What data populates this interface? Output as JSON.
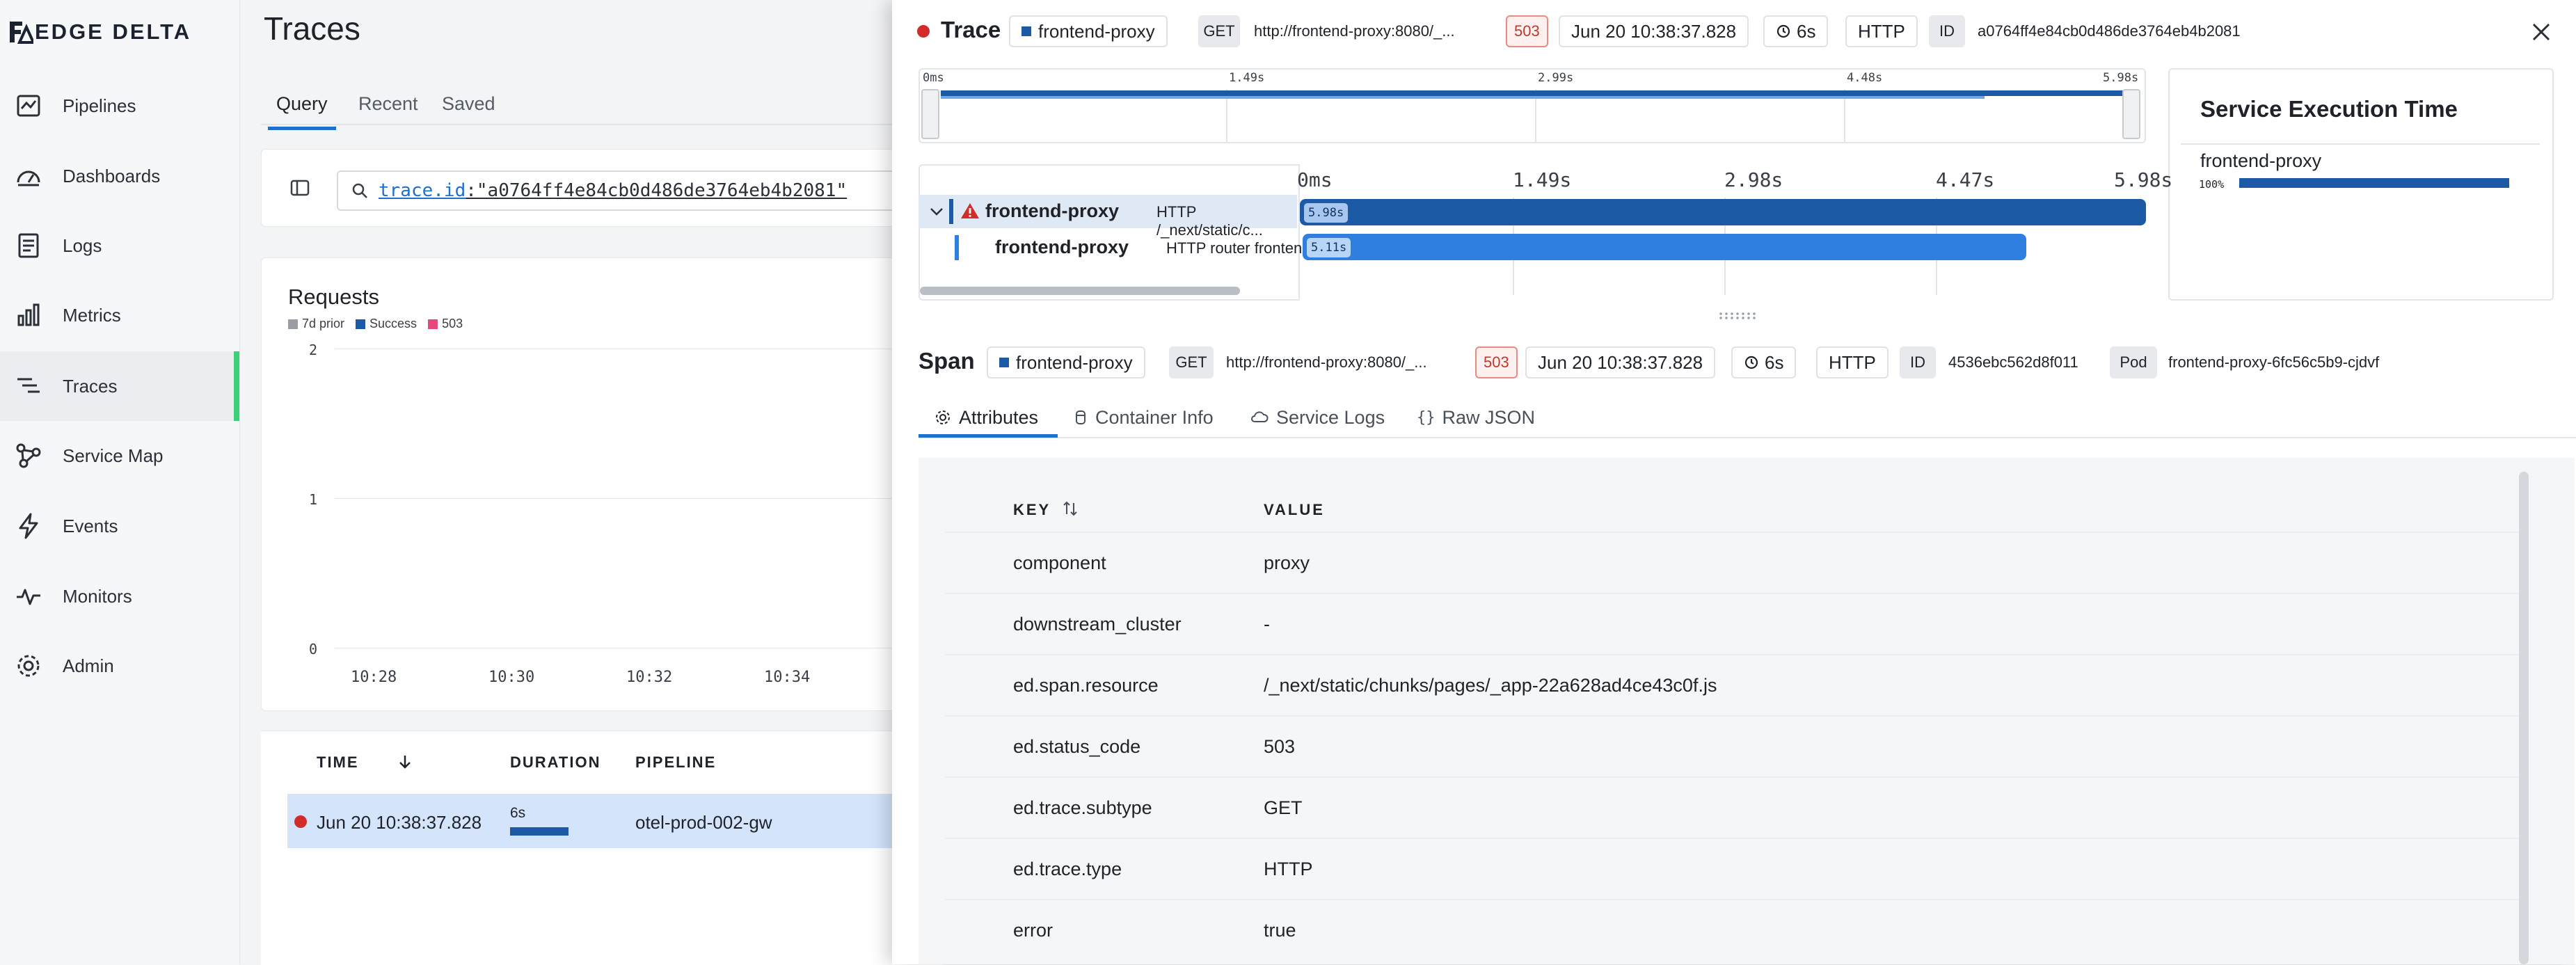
{
  "brand": {
    "name": "EDGE DELTA"
  },
  "nav": [
    {
      "label": "Pipelines",
      "icon": "pipelines-icon"
    },
    {
      "label": "Dashboards",
      "icon": "dashboards-icon"
    },
    {
      "label": "Logs",
      "icon": "logs-icon"
    },
    {
      "label": "Metrics",
      "icon": "metrics-icon"
    },
    {
      "label": "Traces",
      "icon": "traces-icon",
      "active": true
    },
    {
      "label": "Service Map",
      "icon": "service-map-icon"
    },
    {
      "label": "Events",
      "icon": "events-icon"
    },
    {
      "label": "Monitors",
      "icon": "monitors-icon"
    },
    {
      "label": "Admin",
      "icon": "admin-icon"
    }
  ],
  "page": {
    "title": "Traces",
    "tabs": [
      "Query",
      "Recent",
      "Saved"
    ],
    "active_tab": "Query",
    "query": {
      "key": "trace.id",
      "value": ":\"a0764ff4e84cb0d486de3764eb4b2081\""
    }
  },
  "requests_chart": {
    "title": "Requests",
    "legend": [
      {
        "name": "7d prior",
        "color": "#9a9da3"
      },
      {
        "name": "Success",
        "color": "#1d5aa6"
      },
      {
        "name": "503",
        "color": "#e5487a"
      }
    ]
  },
  "chart_data": {
    "type": "bar",
    "title": "Requests",
    "x": [
      "10:28",
      "10:30",
      "10:32",
      "10:34"
    ],
    "yticks": [
      "2",
      "1",
      "0"
    ],
    "ylim": [
      0,
      2
    ],
    "series": [
      {
        "name": "7d prior",
        "values": []
      },
      {
        "name": "Success",
        "values": []
      },
      {
        "name": "503",
        "values": []
      }
    ],
    "grid": true,
    "legend_placement": "top-left"
  },
  "table": {
    "headers": [
      "TIME",
      "DURATION",
      "PIPELINE"
    ],
    "rows": [
      {
        "time": "Jun 20 10:38:37.828",
        "duration": "6s",
        "pipeline": "otel-prod-002-gw",
        "status_color": "#d32a2a"
      }
    ]
  },
  "trace": {
    "label": "Trace",
    "service": "frontend-proxy",
    "method": "GET",
    "url": "http://frontend-proxy:8080/_...",
    "status": "503",
    "timestamp": "Jun 20 10:38:37.828",
    "duration": "6s",
    "protocol": "HTTP",
    "id_label": "ID",
    "id": "a0764ff4e84cb0d486de3764eb4b2081",
    "minimap_ticks": [
      "0ms",
      "1.49s",
      "2.99s",
      "4.48s",
      "5.98s"
    ],
    "waterfall_ticks": [
      "0ms",
      "1.49s",
      "2.98s",
      "4.47s",
      "5.98s"
    ],
    "spans": [
      {
        "name": "frontend-proxy",
        "op": "HTTP /_next/static/c...",
        "badge": "5.98s",
        "fraction": 1.0,
        "error": true
      },
      {
        "name": "frontend-proxy",
        "op": "HTTP router fronten...",
        "badge": "5.11s",
        "fraction": 0.855,
        "error": false
      }
    ]
  },
  "service_execution": {
    "title": "Service Execution Time",
    "service": "frontend-proxy",
    "percent_label": "100%",
    "fraction": 1.0
  },
  "span": {
    "label": "Span",
    "service": "frontend-proxy",
    "method": "GET",
    "url": "http://frontend-proxy:8080/_...",
    "status": "503",
    "timestamp": "Jun 20 10:38:37.828",
    "duration": "6s",
    "protocol": "HTTP",
    "id_label": "ID",
    "id": "4536ebc562d8f011",
    "pod_label": "Pod",
    "pod": "frontend-proxy-6fc56c5b9-cjdvf",
    "tabs": [
      {
        "label": "Attributes",
        "icon": "gear-icon",
        "active": true
      },
      {
        "label": "Container Info",
        "icon": "container-icon"
      },
      {
        "label": "Service Logs",
        "icon": "logs-cloud-icon"
      },
      {
        "label": "Raw JSON",
        "icon": "braces-icon"
      }
    ],
    "attributes": {
      "headers": {
        "key": "KEY",
        "value": "VALUE"
      },
      "rows": [
        {
          "key": "component",
          "value": "proxy"
        },
        {
          "key": "downstream_cluster",
          "value": "-"
        },
        {
          "key": "ed.span.resource",
          "value": "/_next/static/chunks/pages/_app-22a628ad4ce43c0f.js"
        },
        {
          "key": "ed.status_code",
          "value": "503"
        },
        {
          "key": "ed.trace.subtype",
          "value": "GET"
        },
        {
          "key": "ed.trace.type",
          "value": "HTTP"
        },
        {
          "key": "error",
          "value": "true"
        }
      ]
    }
  }
}
